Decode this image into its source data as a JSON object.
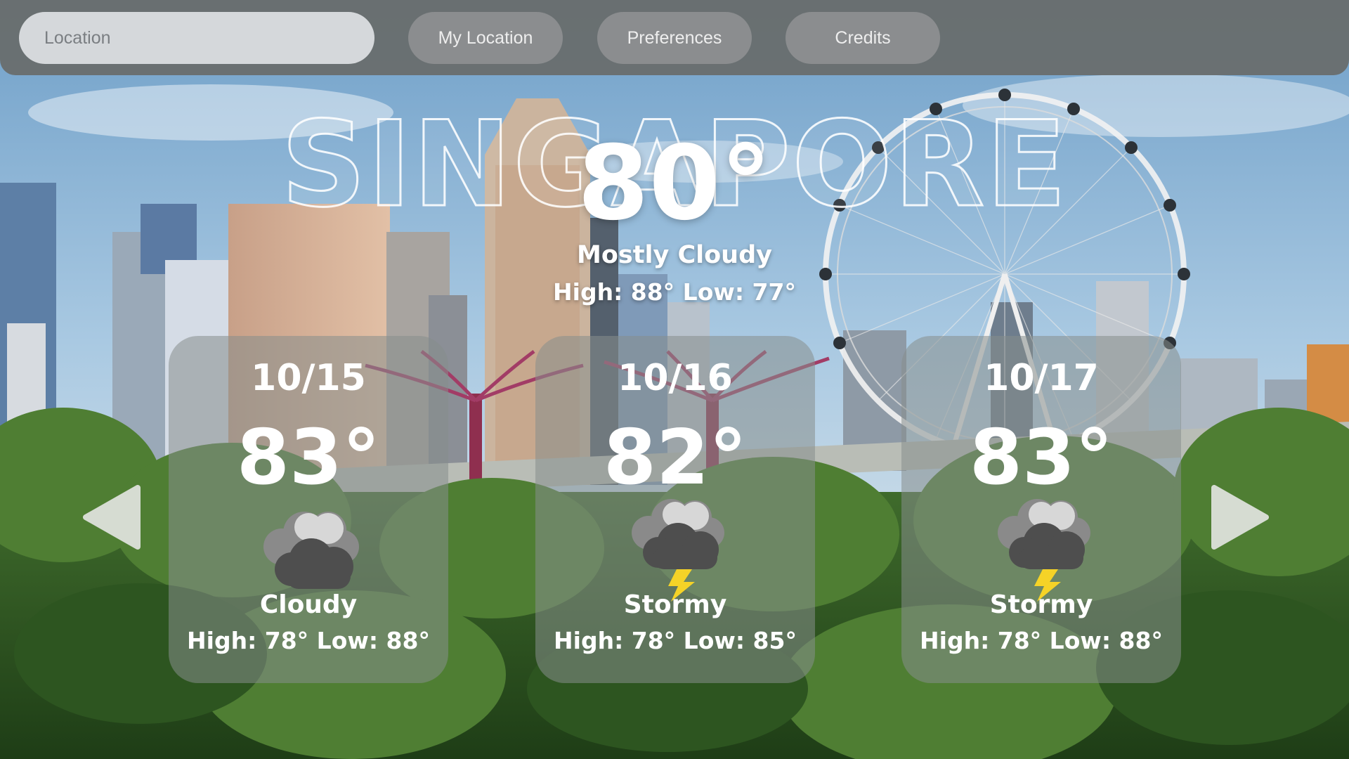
{
  "search": {
    "placeholder": "Location",
    "value": ""
  },
  "nav": {
    "my_location": "My Location",
    "preferences": "Preferences",
    "credits": "Credits"
  },
  "current": {
    "city": "SINGAPORE",
    "temperature": "80°",
    "condition": "Mostly Cloudy",
    "high_low": "High: 88° Low: 77°"
  },
  "forecast": [
    {
      "date": "10/15",
      "temperature": "83°",
      "condition": "Cloudy",
      "high_low": "High: 78° Low: 88°",
      "icon": "cloudy-icon"
    },
    {
      "date": "10/16",
      "temperature": "82°",
      "condition": "Stormy",
      "high_low": "High: 78° Low: 85°",
      "icon": "storm-icon"
    },
    {
      "date": "10/17",
      "temperature": "83°",
      "condition": "Stormy",
      "high_low": "High: 78° Low: 88°",
      "icon": "storm-icon"
    }
  ],
  "arrows": {
    "left": "chevron-left-icon",
    "right": "chevron-right-icon"
  },
  "colors": {
    "topbar": "#6c706e",
    "pill": "#8b8d8f",
    "input": "#d5d8db",
    "lightning": "#f5d327"
  }
}
